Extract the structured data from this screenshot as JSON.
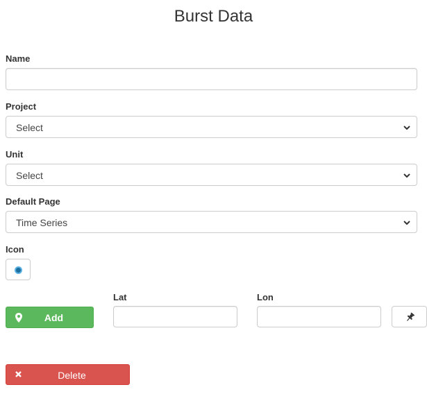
{
  "page": {
    "title": "Burst Data"
  },
  "form": {
    "name": {
      "label": "Name",
      "value": ""
    },
    "project": {
      "label": "Project",
      "selected": "Select"
    },
    "unit": {
      "label": "Unit",
      "selected": "Select"
    },
    "default_page": {
      "label": "Default Page",
      "selected": "Time Series"
    },
    "icon": {
      "label": "Icon",
      "icon_name": "circle-marker-icon",
      "color": "#1b6fa0"
    },
    "location": {
      "add_label": "Add",
      "lat": {
        "label": "Lat",
        "value": ""
      },
      "lon": {
        "label": "Lon",
        "value": ""
      }
    },
    "delete_label": "Delete"
  },
  "colors": {
    "add": "#5cb85c",
    "delete": "#d9534f",
    "border": "#cccccc"
  }
}
